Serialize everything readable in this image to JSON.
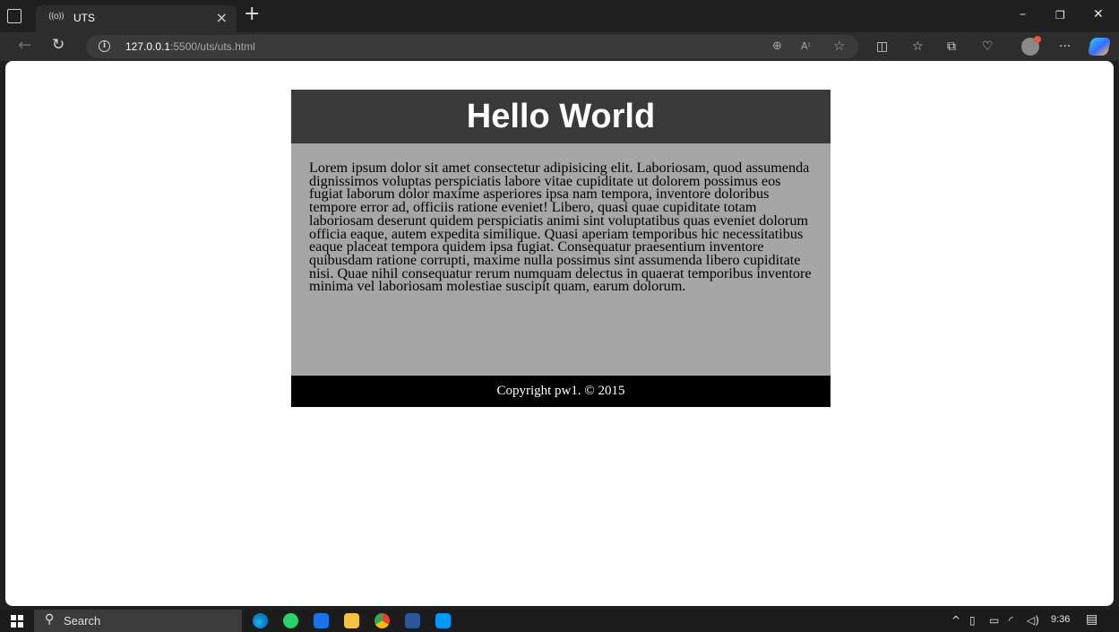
{
  "browser": {
    "tab": {
      "favicon": "((o))",
      "title": "UTS",
      "close": "×"
    },
    "new_tab": "+",
    "window_controls": {
      "minimize": "–",
      "restore": "❐",
      "close": "✕"
    },
    "address": {
      "host": "127.0.0.1",
      "path": ":5500/uts/uts.html"
    },
    "toolbar_icons": [
      "zoom-icon",
      "read-aloud-icon",
      "favorite-star-icon",
      "split-screen-icon",
      "favorites-icon",
      "collections-icon",
      "browser-essentials-icon",
      "profile-icon",
      "more-icon",
      "copilot-icon"
    ],
    "more": "···",
    "read_aloud": "A⁾"
  },
  "page": {
    "title": "Hello World",
    "body": "Lorem ipsum dolor sit amet consectetur adipisicing elit. Laboriosam, quod assumenda dignissimos voluptas perspiciatis labore vitae cupiditate ut dolorem possimus eos fugiat laborum dolor maxime asperiores ipsa nam tempora, inventore doloribus tempore error ad, officiis ratione eveniet! Libero, quasi quae cupiditate totam laboriosam deserunt quidem perspiciatis animi sint voluptatibus quas eveniet dolorum officia eaque, autem expedita similique. Quasi aperiam temporibus hic necessitatibus eaque placeat tempora quidem ipsa fugiat. Consequatur praesentium inventore quibusdam ratione corrupti, maxime nulla possimus sint assumenda libero cupiditate nisi. Quae nihil consequatur rerum numquam delectus in quaerat temporibus inventore minima vel laboriosam molestiae suscipit quam, earum dolorum.",
    "footer": "Copyright pw1. © 2015",
    "colors": {
      "header": "#3a3a3a",
      "body": "#a6a6a6",
      "footer": "#000000"
    }
  },
  "taskbar": {
    "search_label": "Search",
    "apps": [
      "edge-icon",
      "whatsapp-icon",
      "mail-icon",
      "file-explorer-icon",
      "chrome-icon",
      "word-icon",
      "vscode-icon"
    ],
    "tray": {
      "chevron": "^",
      "clock": "9:36"
    }
  }
}
